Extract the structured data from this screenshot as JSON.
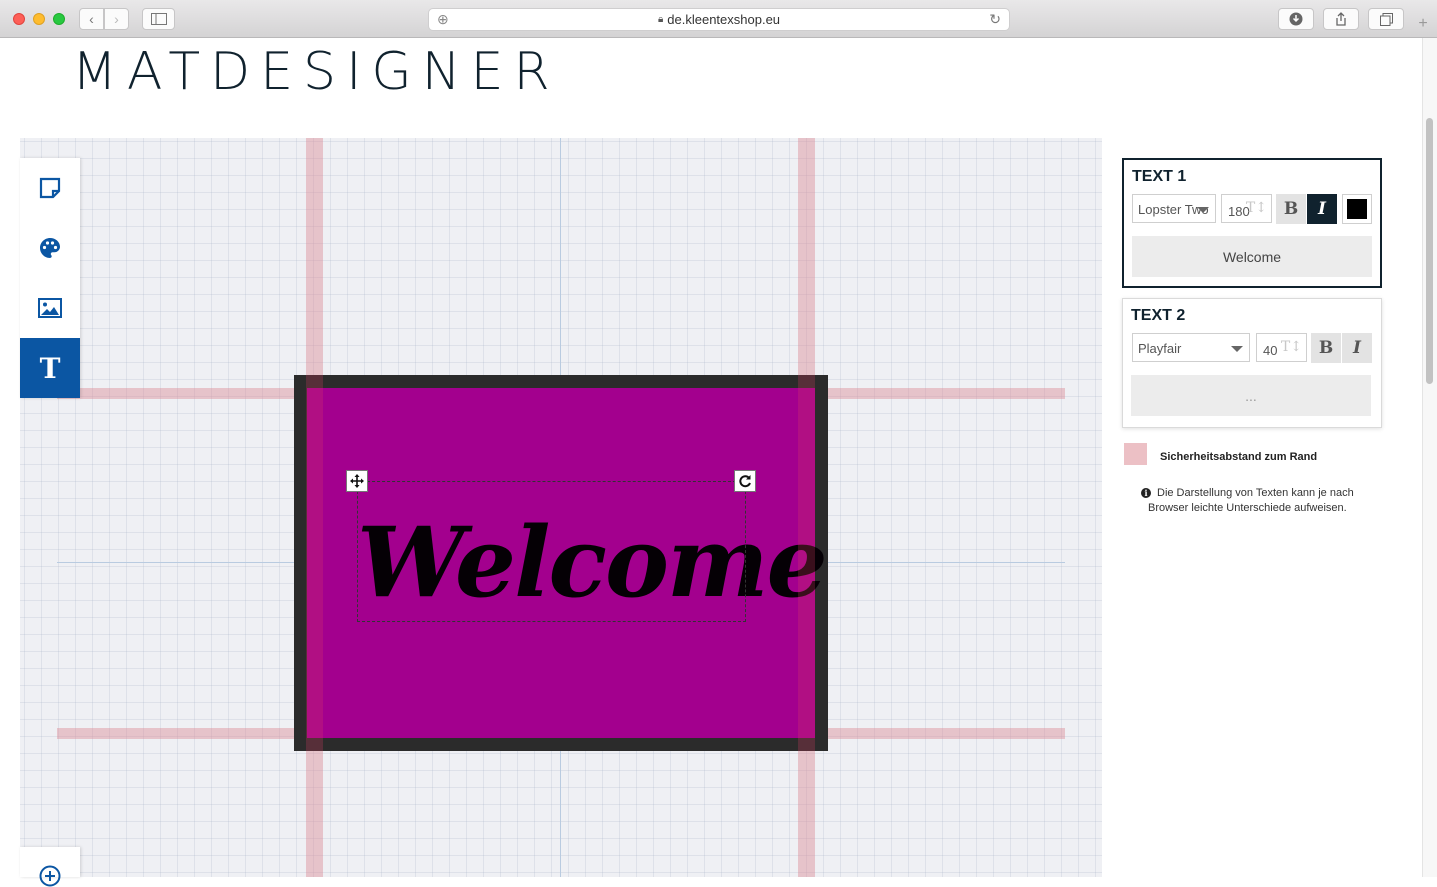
{
  "browser": {
    "url": "de.kleentexshop.eu"
  },
  "page": {
    "logo": "MATDESIGNER"
  },
  "colors": {
    "mat_border": "#2b2b2b",
    "mat_fill": "#a3008e",
    "accent": "#0b56a3",
    "text_color": "#000000",
    "safety_margin": "#dc8c96"
  },
  "toolbar": {
    "items": [
      {
        "icon": "mat-shape-icon",
        "active": false
      },
      {
        "icon": "palette-icon",
        "active": false
      },
      {
        "icon": "image-icon",
        "active": false
      },
      {
        "icon": "text-tool-icon",
        "active": true,
        "glyph": "T"
      }
    ]
  },
  "canvas": {
    "mat_text": "Welcome"
  },
  "text_panels": [
    {
      "title": "TEXT 1",
      "font": "Lopster Two",
      "size": "180",
      "bold_label": "B",
      "italic_label": "I",
      "italic_active": true,
      "text_value": "Welcome",
      "color": "#000000"
    },
    {
      "title": "TEXT 2",
      "font": "Playfair",
      "size": "40",
      "bold_label": "B",
      "italic_label": "I",
      "text_placeholder": "..."
    }
  ],
  "legend": {
    "safety_label": "Sicherheitsabstand zum Rand"
  },
  "note": {
    "text": "Die Darstellung von Texten kann je nach Browser leichte Unterschiede aufweisen."
  }
}
